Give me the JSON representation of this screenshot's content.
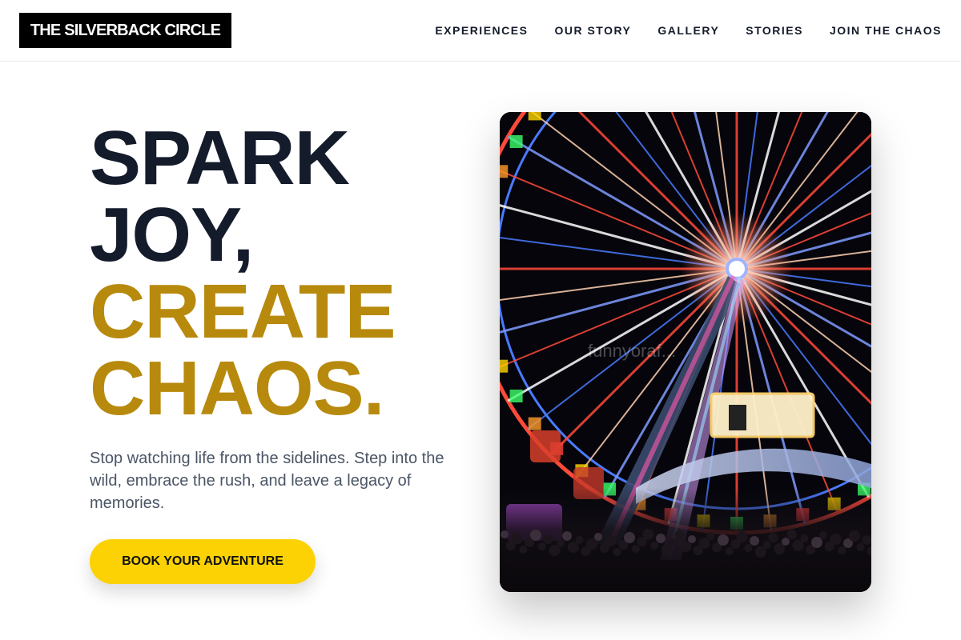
{
  "brand": {
    "logo_text": "THE SILVERBACK CIRCLE"
  },
  "nav": {
    "items": [
      {
        "label": "EXPERIENCES"
      },
      {
        "label": "OUR STORY"
      },
      {
        "label": "GALLERY"
      },
      {
        "label": "STORIES"
      },
      {
        "label": "JOIN THE CHAOS"
      }
    ]
  },
  "hero": {
    "headline": {
      "line1": "SPARK",
      "line2": "JOY,",
      "line3": "CREATE",
      "line4": "CHAOS."
    },
    "description": "Stop watching life from the sidelines. Step into the wild, embrace the rush, and leave a legacy of memories.",
    "cta_label": "BOOK YOUR ADVENTURE",
    "image": {
      "subject": "illuminated ferris wheel at night",
      "watermark": "funnyoraf..."
    }
  },
  "colors": {
    "accent_gold": "#b78a0d",
    "cta_yellow": "#fcd204",
    "ink": "#141b2b",
    "body_text": "#4a5565"
  }
}
